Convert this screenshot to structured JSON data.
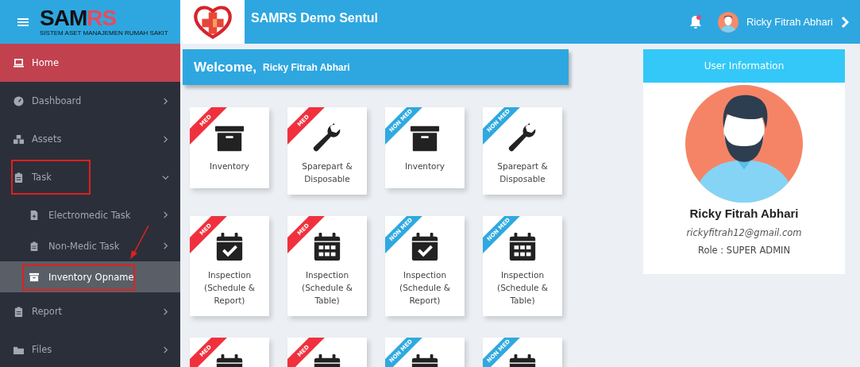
{
  "header": {
    "logo_main": "SAM",
    "logo_accent": "RS",
    "logo_tagline": "SISTEM ASET MANAJEMEN RUMAH SAKIT",
    "app_title": "SAMRS Demo Sentul",
    "notification_unread": true,
    "user_name": "Ricky Fitrah Abhari"
  },
  "sidebar": {
    "items": [
      {
        "label": "Home",
        "kind": "laptop",
        "selected": true,
        "has_submenu": false,
        "expanded": false,
        "highlighted": false
      },
      {
        "label": "Dashboard",
        "kind": "gauge",
        "selected": false,
        "has_submenu": true,
        "expanded": false,
        "highlighted": false
      },
      {
        "label": "Assets",
        "kind": "cubes",
        "selected": false,
        "has_submenu": true,
        "expanded": false,
        "highlighted": false
      },
      {
        "label": "Task",
        "kind": "clipboard",
        "selected": false,
        "has_submenu": true,
        "expanded": true,
        "highlighted": true,
        "children": [
          {
            "label": "Electromedic Task",
            "kind": "file",
            "selected": false,
            "has_submenu": true,
            "highlighted": false
          },
          {
            "label": "Non-Medic Task",
            "kind": "clipboard",
            "selected": false,
            "has_submenu": true,
            "highlighted": false
          },
          {
            "label": "Inventory Opname",
            "kind": "archive",
            "selected": true,
            "has_submenu": false,
            "highlighted": true
          }
        ]
      },
      {
        "label": "Report",
        "kind": "clipboard",
        "selected": false,
        "has_submenu": true,
        "expanded": false,
        "highlighted": false
      },
      {
        "label": "Files",
        "kind": "folder",
        "selected": false,
        "has_submenu": true,
        "expanded": false,
        "highlighted": false
      }
    ]
  },
  "welcome": {
    "greeting": "Welcome,",
    "name": "Ricky Fitrah Abhari"
  },
  "tiles": [
    {
      "ribbon": "MED",
      "color": "#f0313d",
      "kind": "box",
      "lines": [
        "Inventory"
      ]
    },
    {
      "ribbon": "MED",
      "color": "#f0313d",
      "kind": "wrench",
      "lines": [
        "Sparepart &",
        "Disposable"
      ]
    },
    {
      "ribbon": "NON MED",
      "color": "#2fa9e0",
      "kind": "box",
      "lines": [
        "Inventory"
      ]
    },
    {
      "ribbon": "NON MED",
      "color": "#2fa9e0",
      "kind": "wrench",
      "lines": [
        "Sparepart &",
        "Disposable"
      ]
    },
    {
      "ribbon": "MED",
      "color": "#f0313d",
      "kind": "calendar_check",
      "lines": [
        "Inspection",
        "(Schedule &",
        "Report)"
      ]
    },
    {
      "ribbon": "MED",
      "color": "#f0313d",
      "kind": "calendar_grid",
      "lines": [
        "Inspection",
        "(Schedule &",
        "Table)"
      ]
    },
    {
      "ribbon": "NON MED",
      "color": "#2fa9e0",
      "kind": "calendar_check",
      "lines": [
        "Inspection",
        "(Schedule &",
        "Report)"
      ]
    },
    {
      "ribbon": "NON MED",
      "color": "#2fa9e0",
      "kind": "calendar_grid",
      "lines": [
        "Inspection",
        "(Schedule &",
        "Table)"
      ]
    },
    {
      "ribbon": "MED",
      "color": "#f0313d",
      "kind": "calendar_check"
    },
    {
      "ribbon": "MED",
      "color": "#f0313d",
      "kind": "calendar_grid"
    },
    {
      "ribbon": "NON MED",
      "color": "#2fa9e0",
      "kind": "calendar_check"
    },
    {
      "ribbon": "NON MED",
      "color": "#2fa9e0",
      "kind": "calendar_grid"
    }
  ],
  "user_card": {
    "title": "User Information",
    "name": "Ricky Fitrah Abhari",
    "email": "rickyfitrah12@gmail.com",
    "role": "Role : SUPER ADMIN"
  }
}
